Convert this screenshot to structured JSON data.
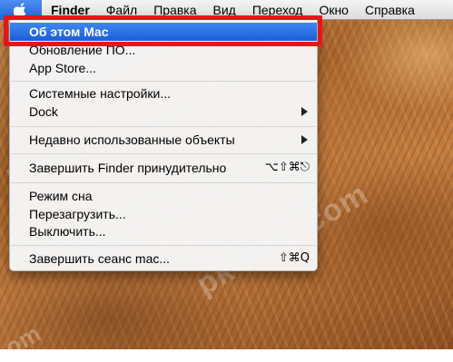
{
  "watermark": {
    "text": "pk-help.com",
    "fragment_left": "um",
    "fragment_bottom": "om"
  },
  "menubar": {
    "apple_icon": "apple-icon",
    "app_name": "Finder",
    "items": [
      "Файл",
      "Правка",
      "Вид",
      "Переход",
      "Окно",
      "Справка"
    ]
  },
  "apple_menu": {
    "items": [
      {
        "label": "Об этом Mac",
        "highlighted": true
      },
      {
        "label": "Обновление ПО..."
      },
      {
        "label": "App Store..."
      },
      {
        "label": "Системные настройки..."
      },
      {
        "label": "Dock",
        "submenu": true
      },
      {
        "label": "Недавно использованные объекты",
        "submenu": true
      },
      {
        "label": "Завершить Finder принудительно",
        "shortcut": "⌥⇧⌘⎋"
      },
      {
        "label": "Режим сна"
      },
      {
        "label": "Перезагрузить..."
      },
      {
        "label": "Выключить..."
      },
      {
        "label": "Завершить сеанс mac...",
        "shortcut": "⇧⌘Q"
      }
    ]
  },
  "colors": {
    "highlight": "#1f63d8",
    "annotation_frame": "#e8141b"
  }
}
